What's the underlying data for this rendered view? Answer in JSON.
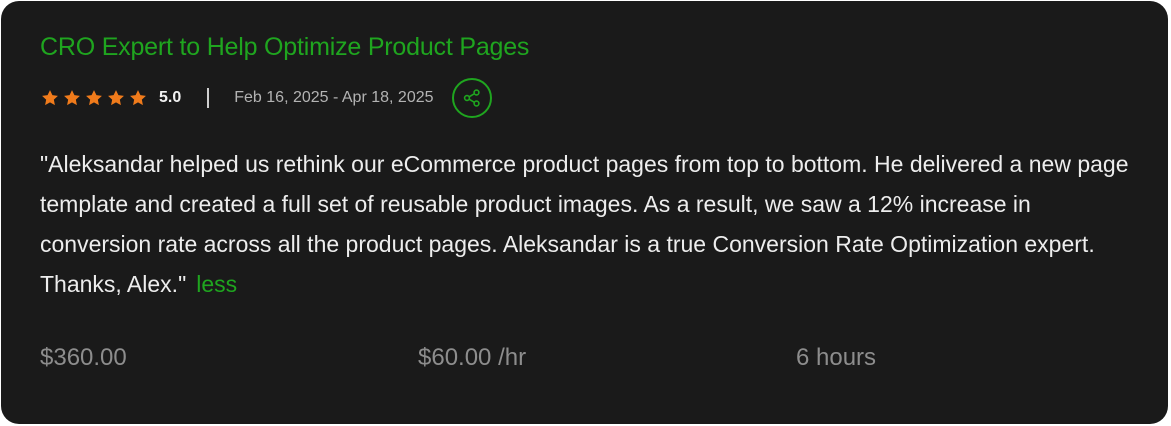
{
  "job": {
    "title": "CRO Expert to Help Optimize Product Pages",
    "rating": "5.0",
    "star_count": 5,
    "dates": "Feb 16, 2025 - Apr 18, 2025",
    "review": "\"Aleksandar helped us rethink our eCommerce product pages from top to bottom. He delivered a new page template and created a full set of reusable product images. As a result, we saw a 12% increase in conversion rate across all the product pages. Aleksandar is a true Conversion Rate Optimization expert. Thanks, Alex.\"",
    "less_link": "less",
    "total": "$360.00",
    "rate": "$60.00 /hr",
    "hours": "6 hours"
  },
  "icons": {
    "star": "star-icon",
    "share": "share-icon"
  },
  "colors": {
    "background": "#1a1a1a",
    "accent_green": "#1fa51f",
    "star_orange": "#f07b1b",
    "muted_text": "#8d8d8d"
  }
}
